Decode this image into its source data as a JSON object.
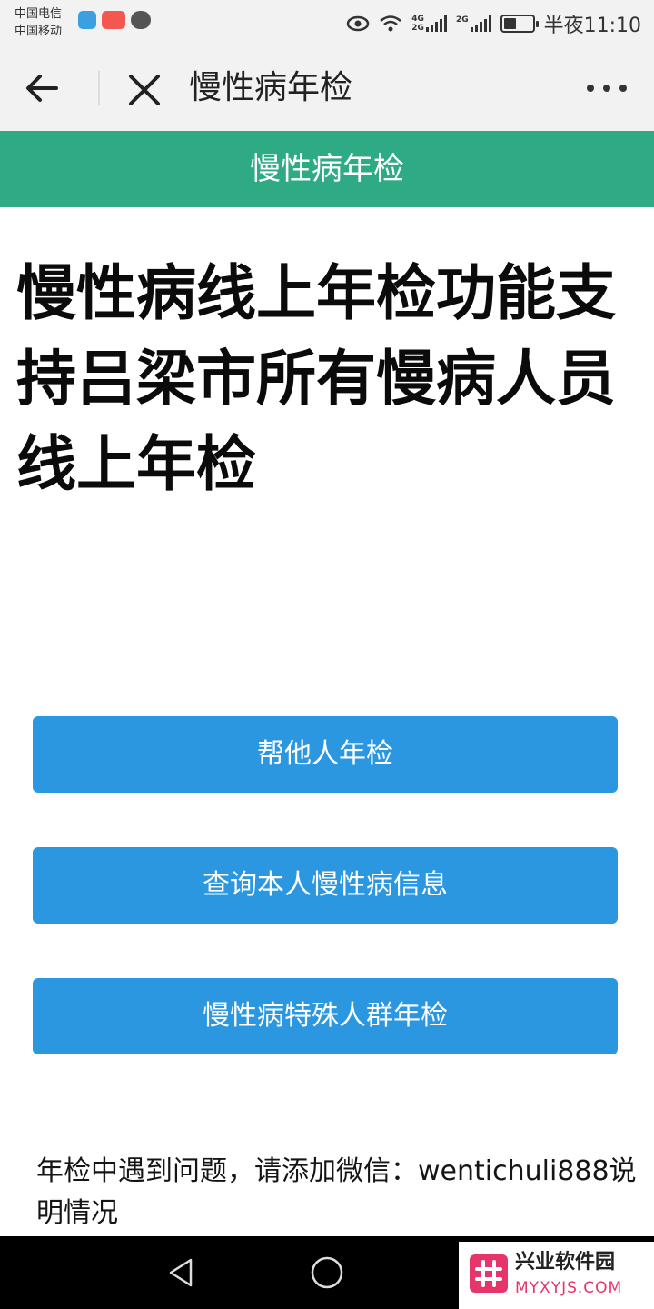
{
  "status_bar": {
    "carrier_1": "中国电信",
    "carrier_2": "中国移动",
    "net_1_top": "4G",
    "net_1_bottom": "2G",
    "net_2": "2G",
    "time": "半夜11:10",
    "battery_level_percent": 45
  },
  "nav": {
    "title": "慢性病年检",
    "icons": [
      "back-arrow-icon",
      "close-icon",
      "more-icon"
    ]
  },
  "banner": {
    "title": "慢性病年检",
    "color": "#2eaa84"
  },
  "headline": "慢性病线上年检功能支持吕梁市所有慢病人员线上年检",
  "buttons": [
    {
      "label": "帮他人年检"
    },
    {
      "label": "查询本人慢性病信息"
    },
    {
      "label": "慢性病特殊人群年检"
    }
  ],
  "button_color": "#2a97e0",
  "note": "年检中遇到问题，请添加微信：wentichuli888说明情况",
  "watermark": {
    "title": "兴业软件园",
    "subtitle": "MYXYJS.COM"
  }
}
